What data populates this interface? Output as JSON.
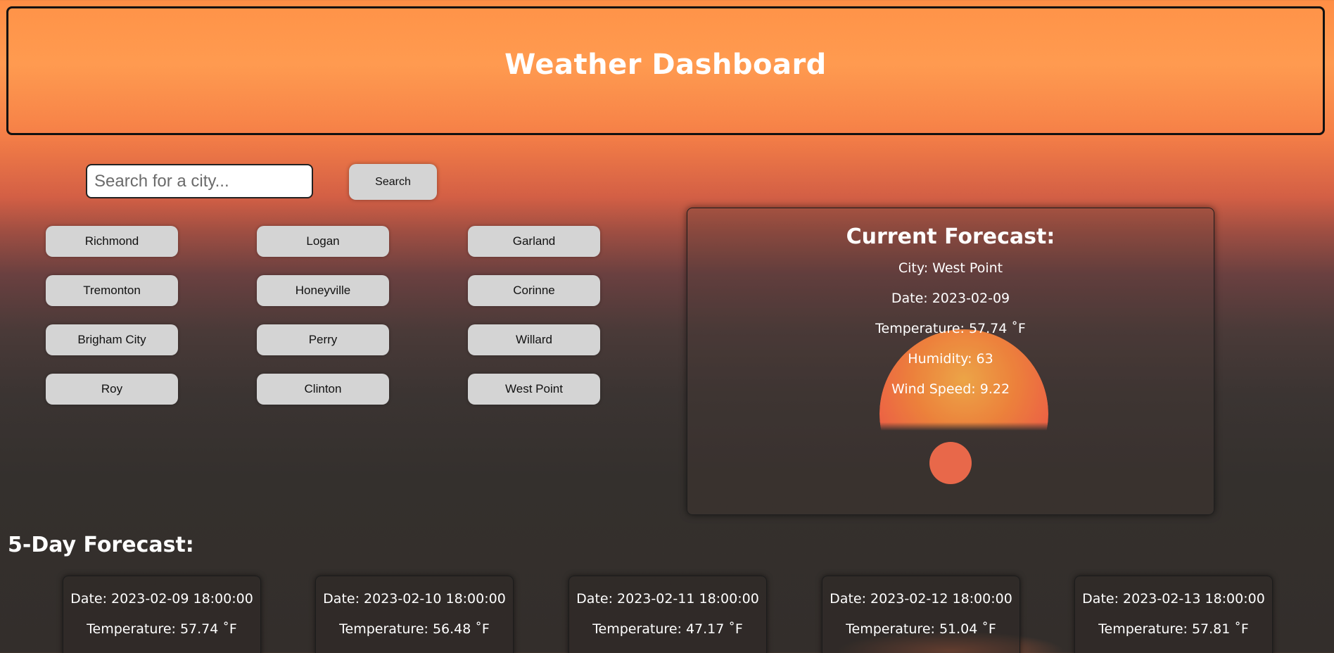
{
  "header": {
    "title": "Weather Dashboard"
  },
  "search": {
    "placeholder": "Search for a city...",
    "value": "",
    "button_label": "Search"
  },
  "cities": [
    "Richmond",
    "Logan",
    "Garland",
    "Tremonton",
    "Honeyville",
    "Corinne",
    "Brigham City",
    "Perry",
    "Willard",
    "Roy",
    "Clinton",
    "West Point"
  ],
  "current": {
    "title": "Current Forecast:",
    "city": "City: West Point",
    "date": "Date: 2023-02-09",
    "temperature": "Temperature: 57.74 ˚F",
    "humidity": "Humidity: 63",
    "wind": "Wind Speed: 9.22",
    "icon": "weather-icon"
  },
  "forecast": {
    "title": "5-Day Forecast:",
    "days": [
      {
        "date": "Date: 2023-02-09 18:00:00",
        "temperature": "Temperature: 57.74 ˚F"
      },
      {
        "date": "Date: 2023-02-10 18:00:00",
        "temperature": "Temperature: 56.48 ˚F"
      },
      {
        "date": "Date: 2023-02-11 18:00:00",
        "temperature": "Temperature: 47.17 ˚F"
      },
      {
        "date": "Date: 2023-02-12 18:00:00",
        "temperature": "Temperature: 51.04 ˚F"
      },
      {
        "date": "Date: 2023-02-13 18:00:00",
        "temperature": "Temperature: 57.81 ˚F"
      }
    ]
  },
  "colors": {
    "header_orange": "#ff9a50",
    "button_gray": "#d4d4d4",
    "weather_icon": "#e8684a"
  }
}
